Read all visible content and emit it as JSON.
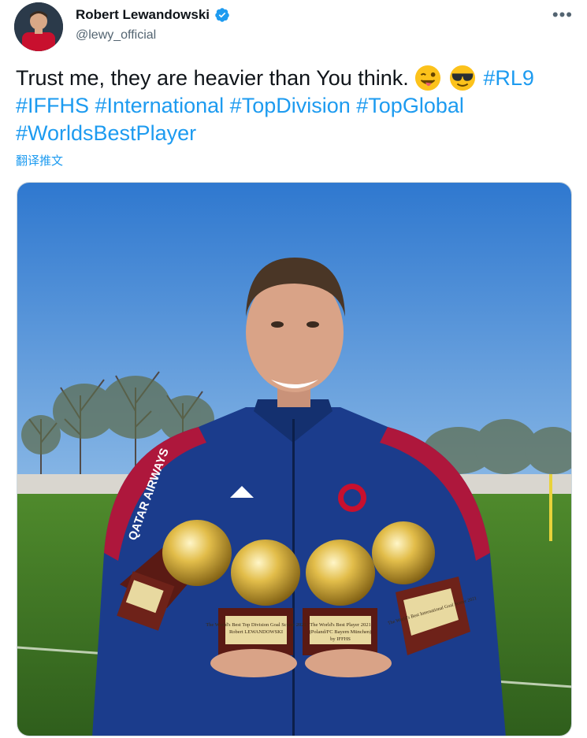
{
  "author": {
    "name": "Robert Lewandowski",
    "handle": "@lewy_official",
    "verified": true
  },
  "menu": {
    "more_label": "•••"
  },
  "tweet": {
    "text_plain": "Trust me, they are heavier than You think.",
    "emojis": [
      "winking-tongue-emoji",
      "sunglasses-emoji"
    ],
    "hashtags": [
      "#RL9",
      "#IFFHS",
      "#International",
      "#TopDivision",
      "#TopGlobal",
      "#WorldsBestPlayer"
    ],
    "translate_label": "翻译推文"
  },
  "media": {
    "sponsor": "QATAR AIRWAYS",
    "trophy_plates": [
      "The World's Best Top Division Goal Scorer 2021",
      "The World's Best Player 2021",
      "The World's Best International Goal Scorer 2021"
    ],
    "plate_name": "Robert LEWANDOWSKI",
    "plate_club": "(Poland/FC Bayern München)",
    "plate_by": "by IFFHS"
  },
  "colors": {
    "link": "#1d9bf0",
    "secondary_text": "#536471",
    "sky": "#3e86d6",
    "jacket": "#1b3c8c"
  }
}
